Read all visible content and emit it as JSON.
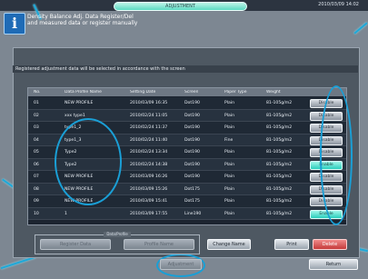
{
  "window": {
    "title": "ADJUSTMENT",
    "datetime": "2010/03/09 14:02"
  },
  "header": {
    "description_line1": "Density Balance Adj. Data Register/Del",
    "description_line2": "and measured data or register manually"
  },
  "notice": "Registered adjustment data will be selected in accordance with the screen",
  "table": {
    "columns": [
      "No.",
      "Data Profile Name",
      "Setting Date",
      "Screen",
      "Paper Type",
      "Weight",
      ""
    ],
    "rows": [
      {
        "no": "01",
        "name": "NEW PROFILE",
        "date": "2010/03/09 16:35",
        "screen": "Dot190",
        "paper": "Plain",
        "weight": "81-105g/m2",
        "state": "Disable",
        "active": false
      },
      {
        "no": "02",
        "name": "xxx type1",
        "date": "2010/02/24 11:05",
        "screen": "Dot190",
        "paper": "Plain",
        "weight": "81-105g/m2",
        "state": "Disable",
        "active": false
      },
      {
        "no": "03",
        "name": "type1_2",
        "date": "2010/02/24 11:37",
        "screen": "Dot190",
        "paper": "Plain",
        "weight": "81-105g/m2",
        "state": "Disable",
        "active": false
      },
      {
        "no": "04",
        "name": "type1_3",
        "date": "2010/02/24 11:40",
        "screen": "Dot190",
        "paper": "Fine",
        "weight": "81-105g/m2",
        "state": "Disable",
        "active": false
      },
      {
        "no": "05",
        "name": "Type2",
        "date": "2010/02/24 13:34",
        "screen": "Dot190",
        "paper": "Plain",
        "weight": "81-105g/m2",
        "state": "Disable",
        "active": false
      },
      {
        "no": "06",
        "name": "Type2",
        "date": "2010/02/24 14:38",
        "screen": "Dot190",
        "paper": "Plain",
        "weight": "81-105g/m2",
        "state": "Enable",
        "active": true
      },
      {
        "no": "07",
        "name": "NEW PROFILE",
        "date": "2010/03/09 16:26",
        "screen": "Dot190",
        "paper": "Plain",
        "weight": "81-105g/m2",
        "state": "Disable",
        "active": false
      },
      {
        "no": "08",
        "name": "NEW PROFILE",
        "date": "2010/03/09 15:26",
        "screen": "Dot175",
        "paper": "Plain",
        "weight": "81-105g/m2",
        "state": "Disable",
        "active": false
      },
      {
        "no": "09",
        "name": "NEW PROFILE",
        "date": "2010/03/09 15:41",
        "screen": "Dot175",
        "paper": "Plain",
        "weight": "81-105g/m2",
        "state": "Disable",
        "active": false
      },
      {
        "no": "10",
        "name": "1",
        "date": "2010/03/09 17:55",
        "screen": "Line190",
        "paper": "Plain",
        "weight": "81-105g/m2",
        "state": "Enable",
        "active": true
      }
    ]
  },
  "bottom": {
    "group_label": "Data/Profile",
    "btn_register": "Register Data",
    "btn_name": "Profile Name",
    "btn_change_name": "Change Name",
    "btn_center": "Adjustment",
    "btn_print": "Print",
    "btn_delete": "Delete",
    "btn_return": "Return"
  },
  "colors": {
    "accent_cyan": "#1a9fd6",
    "enable_btn": "#29cdbb",
    "delete_btn": "#c53a3a"
  }
}
